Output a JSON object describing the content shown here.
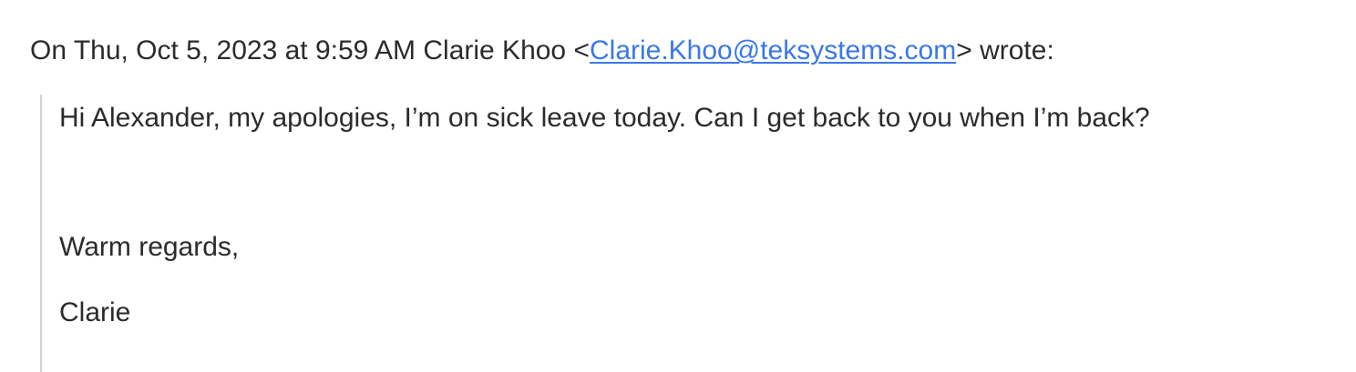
{
  "email": {
    "attribution": {
      "prefix": "On Thu, Oct 5, 2023 at 9:59 AM Clarie Khoo <",
      "email_link": "Clarie.Khoo@teksystems.com",
      "suffix": "> wrote:"
    },
    "quoted_message": {
      "body": "Hi Alexander, my apologies, I’m on sick leave today. Can I get back to you when I’m back?",
      "closing": "Warm regards,",
      "signature": "Clarie"
    }
  }
}
